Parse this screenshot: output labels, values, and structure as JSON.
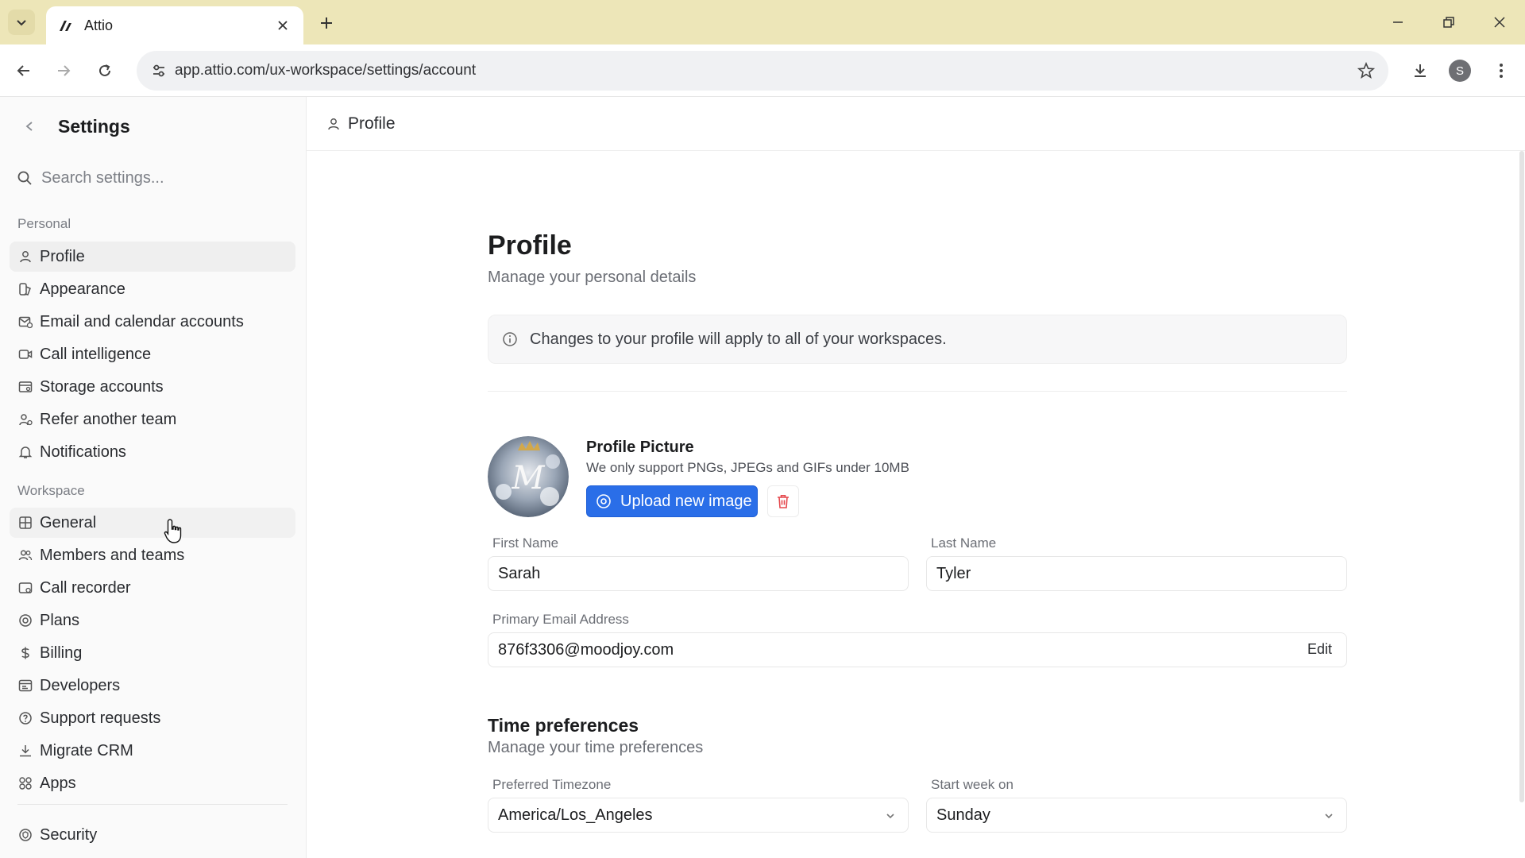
{
  "browser": {
    "tab_title": "Attio",
    "url": "app.attio.com/ux-workspace/settings/account",
    "profile_initial": "S"
  },
  "sidebar": {
    "title": "Settings",
    "search_placeholder": "Search settings...",
    "personal_label": "Personal",
    "personal_items": [
      {
        "label": "Profile",
        "icon": "person-icon"
      },
      {
        "label": "Appearance",
        "icon": "palette-icon"
      },
      {
        "label": "Email and calendar accounts",
        "icon": "mail-calendar-icon"
      },
      {
        "label": "Call intelligence",
        "icon": "video-icon"
      },
      {
        "label": "Storage accounts",
        "icon": "storage-icon"
      },
      {
        "label": "Refer another team",
        "icon": "refer-icon"
      },
      {
        "label": "Notifications",
        "icon": "bell-icon"
      }
    ],
    "workspace_label": "Workspace",
    "workspace_items": [
      {
        "label": "General",
        "icon": "grid-icon"
      },
      {
        "label": "Members and teams",
        "icon": "users-icon"
      },
      {
        "label": "Call recorder",
        "icon": "recorder-icon"
      },
      {
        "label": "Plans",
        "icon": "plans-icon"
      },
      {
        "label": "Billing",
        "icon": "dollar-icon"
      },
      {
        "label": "Developers",
        "icon": "code-icon"
      },
      {
        "label": "Support requests",
        "icon": "help-icon"
      },
      {
        "label": "Migrate CRM",
        "icon": "download-icon"
      },
      {
        "label": "Apps",
        "icon": "apps-icon"
      }
    ],
    "security_label": "Security"
  },
  "header": {
    "title": "Profile"
  },
  "profile": {
    "title": "Profile",
    "subtitle": "Manage your personal details",
    "notice": "Changes to your profile will apply to all of your workspaces.",
    "picture_title": "Profile Picture",
    "picture_sub": "We only support PNGs, JPEGs and GIFs under 10MB",
    "upload_label": "Upload new image",
    "first_name_label": "First Name",
    "first_name": "Sarah",
    "last_name_label": "Last Name",
    "last_name": "Tyler",
    "email_label": "Primary Email Address",
    "email": "876f3306@moodjoy.com",
    "edit_label": "Edit"
  },
  "time": {
    "title": "Time preferences",
    "subtitle": "Manage your time preferences",
    "timezone_label": "Preferred Timezone",
    "timezone": "America/Los_Angeles",
    "week_label": "Start week on",
    "week_start": "Sunday"
  },
  "colors": {
    "accent": "#2a6ee8",
    "danger": "#e5484d",
    "tabbar": "#ede6b8"
  }
}
